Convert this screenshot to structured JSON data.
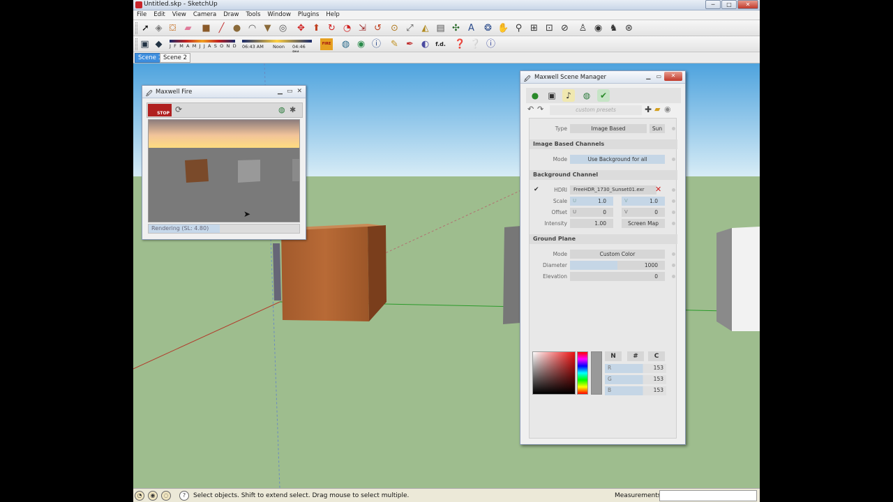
{
  "window": {
    "title": "Untitled.skp - SketchUp",
    "min": "─",
    "max": "□",
    "close": "✕"
  },
  "menu": [
    "File",
    "Edit",
    "View",
    "Camera",
    "Draw",
    "Tools",
    "Window",
    "Plugins",
    "Help"
  ],
  "shadow": {
    "months": "J F M A M J J A S O N D",
    "time_start": "06:43 AM",
    "time_noon": "Noon",
    "time_end": "04:46 PM"
  },
  "fire_label": "FIRE",
  "fd_label": "f.d.",
  "scenes": [
    "Scene 1",
    "Scene 2"
  ],
  "status": {
    "text": "Select objects. Shift to extend select. Drag mouse to select multiple.",
    "measurements_label": "Measurements",
    "measurements_value": ""
  },
  "maxwell_fire": {
    "title": "Maxwell Fire",
    "stop_label": "STOP",
    "progress_text": "Rendering (SL: 4.80)",
    "progress_fraction": 0.47
  },
  "scene_manager": {
    "title": "Maxwell Scene Manager",
    "presets_placeholder": "custom presets",
    "type_label": "Type",
    "type_value": "Image Based",
    "sun_label": "Sun",
    "ibc_section": "Image Based Channels",
    "mode_label": "Mode",
    "ibc_mode_value": "Use Background for all",
    "bg_section": "Background Channel",
    "hdri_label": "HDRI",
    "hdri_value": "FreeHDR_1730_Sunset01.exr",
    "scale_label": "Scale",
    "u_label": "U",
    "v_label": "V",
    "scale_u": "1.0",
    "scale_v": "1.0",
    "offset_label": "Offset",
    "offset_u": "0",
    "offset_v": "0",
    "intensity_label": "Intensity",
    "intensity_value": "1.00",
    "screen_map_label": "Screen Map",
    "ground_section": "Ground Plane",
    "gp_mode_value": "Custom Color",
    "diameter_label": "Diameter",
    "diameter_value": "1000",
    "elevation_label": "Elevation",
    "elevation_value": "0",
    "color_modes": [
      "N",
      "#",
      "C"
    ],
    "rgb": [
      {
        "k": "R",
        "v": "153"
      },
      {
        "k": "G",
        "v": "153"
      },
      {
        "k": "B",
        "v": "153"
      }
    ]
  },
  "colors": {
    "sky": "#5aa9e0",
    "ground": "#9ebd8e",
    "accent_blue": "#3e8ede",
    "stop_red": "#b02020"
  }
}
